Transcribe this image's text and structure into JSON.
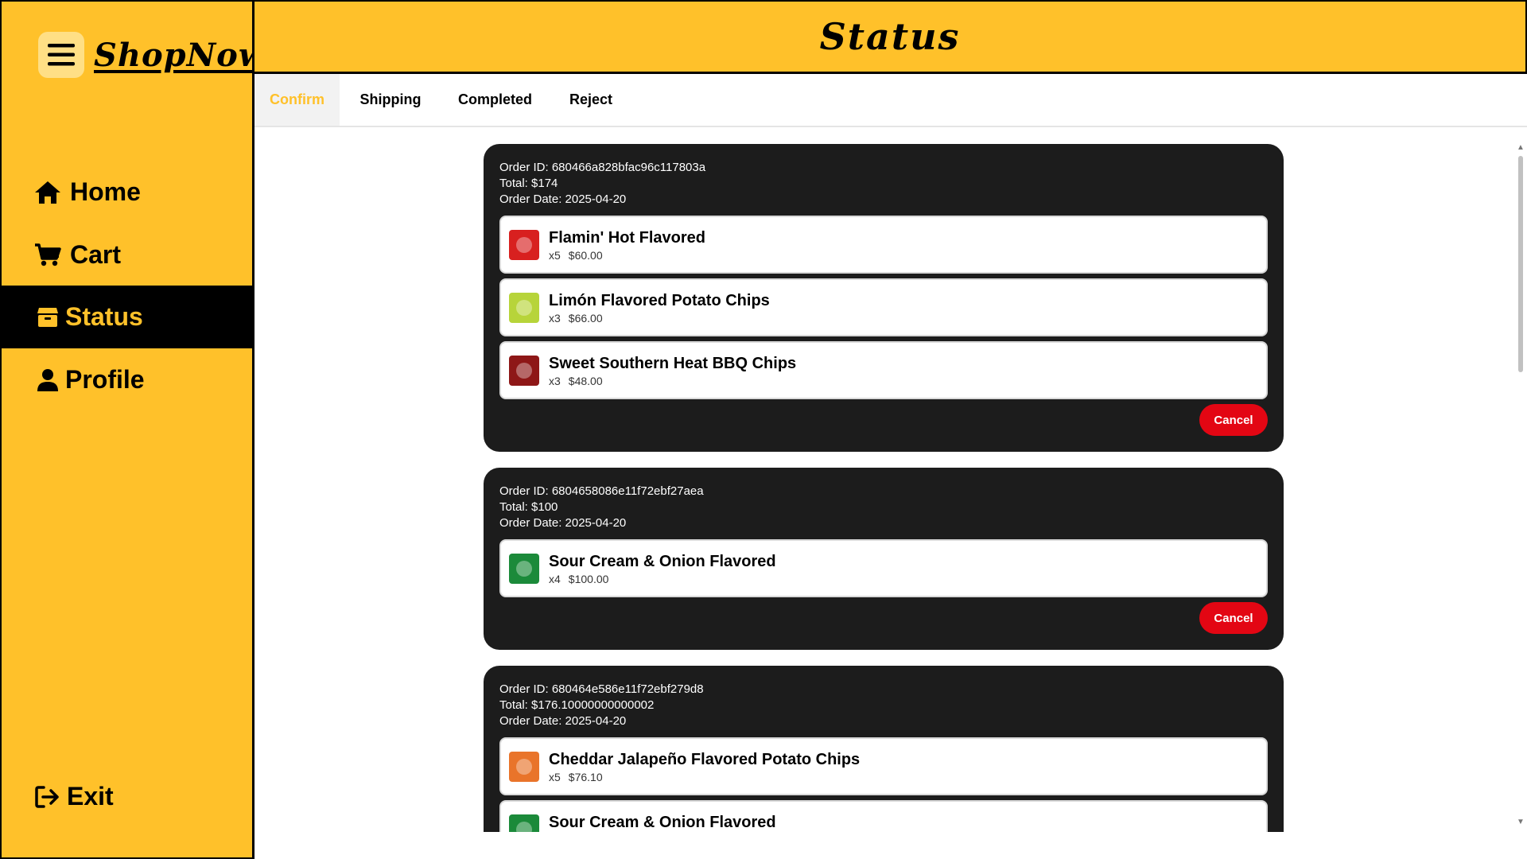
{
  "app": {
    "brand": "ShopNow",
    "menu_icon": "hamburger-menu-icon",
    "colors": {
      "brand_yellow": "#FFC12A",
      "dark_card": "#1C1C1C",
      "cancel_red": "#E30613"
    }
  },
  "sidebar": {
    "items": [
      {
        "label": "Home",
        "icon": "home-icon",
        "active": false
      },
      {
        "label": "Cart",
        "icon": "cart-icon",
        "active": false
      },
      {
        "label": "Status",
        "icon": "box-icon",
        "active": true
      },
      {
        "label": "Profile",
        "icon": "user-icon",
        "active": false
      }
    ],
    "exit": {
      "label": "Exit",
      "icon": "exit-icon"
    }
  },
  "header": {
    "title": "Status"
  },
  "tabs": [
    {
      "label": "Confirm",
      "active": true
    },
    {
      "label": "Shipping",
      "active": false
    },
    {
      "label": "Completed",
      "active": false
    },
    {
      "label": "Reject",
      "active": false
    }
  ],
  "orders": [
    {
      "id_line": "Order ID: 680466a828bfac96c117803a",
      "total_line": "Total: $174",
      "date_line": "Order Date: 2025-04-20",
      "cancel_label": "Cancel",
      "items": [
        {
          "name": "Flamin' Hot Flavored",
          "qty": "x5",
          "price": "$60.00",
          "thumb_color": "#D8201F"
        },
        {
          "name": "Limón Flavored Potato Chips",
          "qty": "x3",
          "price": "$66.00",
          "thumb_color": "#B7D43A"
        },
        {
          "name": "Sweet Southern Heat BBQ Chips",
          "qty": "x3",
          "price": "$48.00",
          "thumb_color": "#8E1717"
        }
      ]
    },
    {
      "id_line": "Order ID: 6804658086e11f72ebf27aea",
      "total_line": "Total: $100",
      "date_line": "Order Date: 2025-04-20",
      "cancel_label": "Cancel",
      "items": [
        {
          "name": "Sour Cream & Onion Flavored",
          "qty": "x4",
          "price": "$100.00",
          "thumb_color": "#1B8A3A"
        }
      ]
    },
    {
      "id_line": "Order ID: 680464e586e11f72ebf279d8",
      "total_line": "Total: $176.10000000000002",
      "date_line": "Order Date: 2025-04-20",
      "cancel_label": "",
      "items": [
        {
          "name": "Cheddar Jalapeño Flavored Potato Chips",
          "qty": "x5",
          "price": "$76.10",
          "thumb_color": "#E9742A"
        },
        {
          "name": "Sour Cream & Onion Flavored",
          "qty": "",
          "price": "",
          "thumb_color": "#1B8A3A"
        }
      ]
    }
  ]
}
